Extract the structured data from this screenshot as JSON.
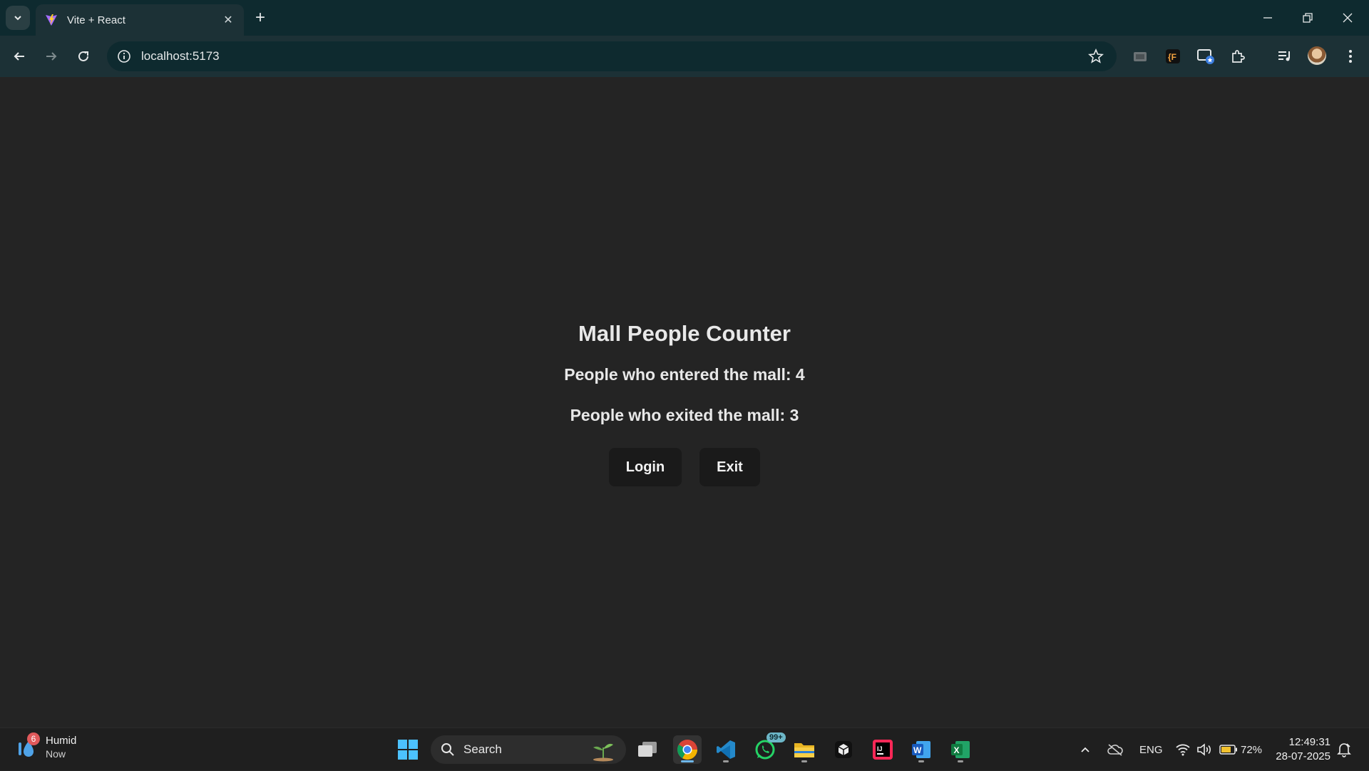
{
  "browser": {
    "tab_title": "Vite + React",
    "url": "localhost:5173",
    "new_tab_symbol": "+",
    "close_symbol": "✕"
  },
  "app": {
    "title": "Mall People Counter",
    "entered_text": "People who entered the mall: 4",
    "exited_text": "People who exited the mall: 3",
    "login_label": "Login",
    "exit_label": "Exit"
  },
  "taskbar": {
    "weather_badge": "6",
    "weather_line1": "Humid",
    "weather_line2": "Now",
    "search_label": "Search",
    "whatsapp_badge": "99+",
    "language": "ENG",
    "battery_percent": "72%",
    "time": "12:49:31",
    "date": "28-07-2025"
  },
  "colors": {
    "page_bg": "#242424",
    "chrome_dark": "#0e2a2f",
    "chrome_toolbar": "#1c3136",
    "button_bg": "#1a1a1a"
  }
}
